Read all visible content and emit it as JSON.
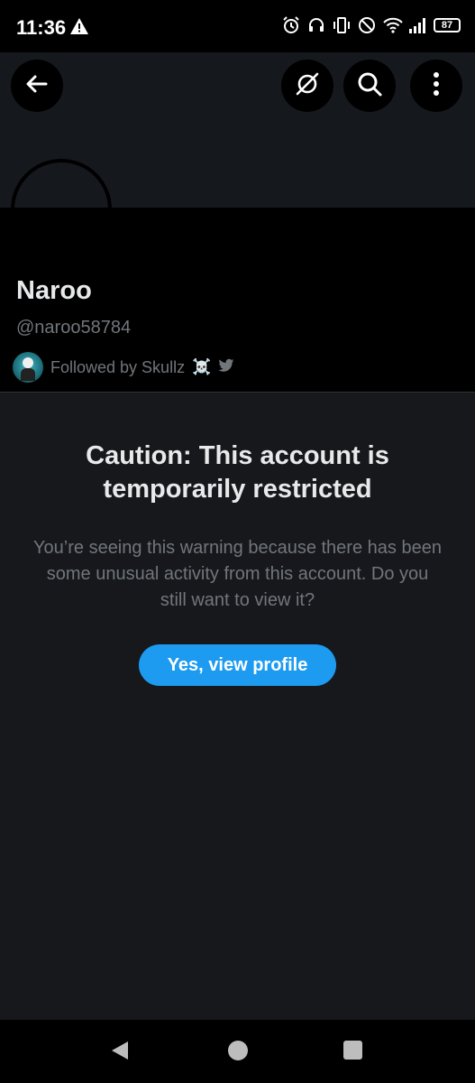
{
  "status_bar": {
    "time": "11:36",
    "battery": "87"
  },
  "icons": {
    "back": "arrow-left-icon",
    "no_image": "image-off-icon",
    "search": "search-icon",
    "more": "more-vertical-icon",
    "warning": "warning-triangle-icon",
    "alarm": "alarm-icon",
    "headset": "headset-icon",
    "vibrate": "vibrate-icon",
    "dnd": "do-not-disturb-icon",
    "wifi": "wifi-icon",
    "signal": "signal-icon",
    "bird": "twitter-bird-icon"
  },
  "profile": {
    "name": "Naroo",
    "handle": "@naroo58784",
    "followed_by": "Followed by Skullz",
    "followed_by_emoji": "☠️"
  },
  "warning": {
    "title": "Caution: This account is temporarily restricted",
    "body": "You’re seeing this warning because there has been some unusual activity from this account. Do you still want to view it?",
    "button_label": "Yes, view profile"
  },
  "colors": {
    "accent": "#1d9bf0",
    "background": "#000000",
    "panel": "#16181c",
    "muted_text": "#71767b"
  }
}
